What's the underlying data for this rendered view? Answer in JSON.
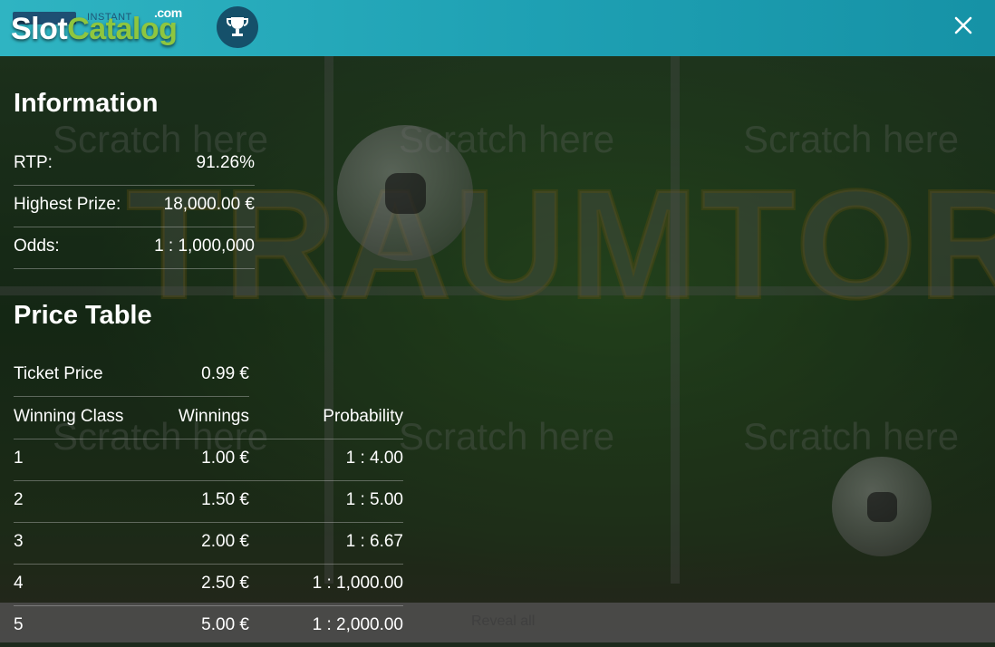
{
  "header": {
    "provider_label": "INSTANT",
    "watermark_slot": "Slot",
    "watermark_catalog": "Catalog",
    "watermark_com": ".com",
    "trophy_icon": "trophy-icon",
    "close_icon": "close-icon"
  },
  "background": {
    "scratch_label": "Scratch here",
    "game_logo": "TRAUMTOR",
    "bottom_button": "Reveal all"
  },
  "information": {
    "title": "Information",
    "rows": [
      {
        "label": "RTP:",
        "value": "91.26%"
      },
      {
        "label": "Highest Prize:",
        "value": "18,000.00 €"
      },
      {
        "label": "Odds:",
        "value": "1 : 1,000,000"
      }
    ]
  },
  "price_table": {
    "title": "Price Table",
    "ticket_label": "Ticket Price",
    "ticket_value": "0.99 €",
    "headers": {
      "class": "Winning Class",
      "winnings": "Winnings",
      "probability": "Probability"
    },
    "rows": [
      {
        "class": "1",
        "winnings": "1.00 €",
        "probability": "1 : 4.00"
      },
      {
        "class": "2",
        "winnings": "1.50 €",
        "probability": "1 : 5.00"
      },
      {
        "class": "3",
        "winnings": "2.00 €",
        "probability": "1 : 6.67"
      },
      {
        "class": "4",
        "winnings": "2.50 €",
        "probability": "1 : 1,000.00"
      },
      {
        "class": "5",
        "winnings": "5.00 €",
        "probability": "1 : 2,000.00"
      }
    ]
  },
  "colors": {
    "header": "#1ea0b3",
    "trophy_bg": "#15506a",
    "watermark_green": "#8ec63f"
  }
}
